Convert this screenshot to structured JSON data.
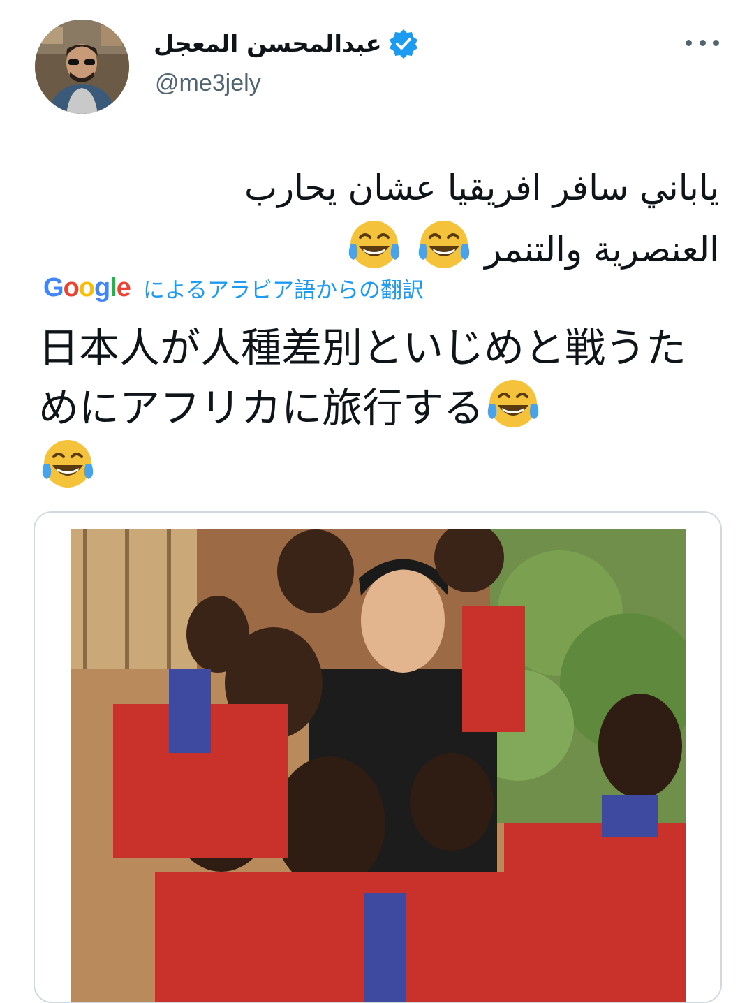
{
  "author": {
    "display_name": "عبدالمحسن المعجل",
    "handle": "@me3jely",
    "verified": true
  },
  "tweet": {
    "text": "ياباني سافر افريقيا عشان يحارب العنصرية والتنمر",
    "emoji_count": 2
  },
  "translation": {
    "provider": "Google",
    "label": "によるアラビア語からの翻訳",
    "text": "日本人が人種差別といじめと戦うためにアフリカに旅行する"
  },
  "icons": {
    "more": "more-options-icon",
    "verified": "verified-badge-icon",
    "emoji": "face-with-tears-of-joy-emoji"
  },
  "colors": {
    "accent": "#1d9bf0",
    "text": "#0f1419",
    "secondary": "#536471"
  }
}
